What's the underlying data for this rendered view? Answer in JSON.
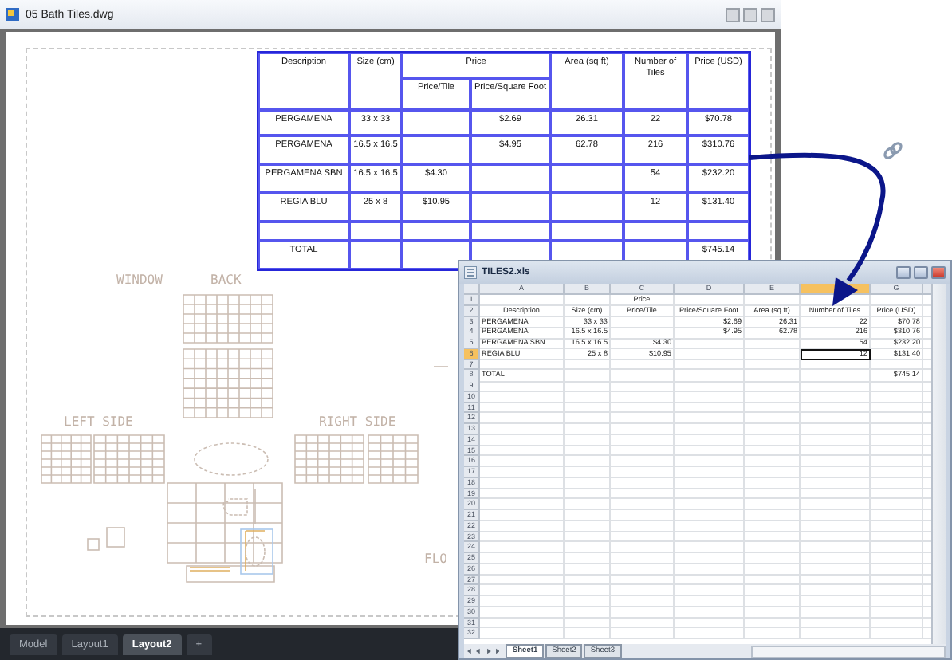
{
  "cad_window": {
    "title": "05 Bath Tiles.dwg",
    "table": {
      "columns": [
        {
          "label": "Description",
          "kind": "single"
        },
        {
          "label": "Size (cm)",
          "kind": "single"
        },
        {
          "label": "Price/Tile",
          "kind": "group_start",
          "group": "Price"
        },
        {
          "label": "Price/Square Foot",
          "kind": "group_member"
        },
        {
          "label": "Area (sq ft)",
          "kind": "single"
        },
        {
          "label": "Number of Tiles",
          "kind": "single"
        },
        {
          "label": "Price (USD)",
          "kind": "single"
        }
      ],
      "rows": [
        {
          "cells": [
            "PERGAMENA",
            "33 x 33",
            null,
            "$2.69",
            "26.31",
            "22",
            "$70.78"
          ]
        },
        {
          "cells": [
            "PERGAMENA",
            "16.5 x 16.5",
            null,
            "$4.95",
            "62.78",
            "216",
            "$310.76"
          ]
        },
        {
          "cells": [
            "PERGAMENA SBN",
            "16.5 x 16.5",
            "$4.30",
            null,
            null,
            "54",
            "$232.20"
          ]
        },
        {
          "cells": [
            "REGIA BLU",
            "25 x 8",
            "$10.95",
            null,
            null,
            "12",
            "$131.40"
          ]
        },
        {
          "cells": [
            null,
            null,
            null,
            null,
            null,
            null,
            null
          ]
        },
        {
          "cells": [
            "TOTAL",
            null,
            null,
            null,
            null,
            null,
            "$745.14"
          ]
        }
      ]
    },
    "drawing_labels": [
      "WINDOW",
      "BACK",
      "LEFT SIDE",
      "RIGHT SIDE",
      "FLO"
    ],
    "layout_tabs": [
      {
        "label": "Model",
        "selected": false
      },
      {
        "label": "Layout1",
        "selected": false
      },
      {
        "label": "Layout2",
        "selected": true
      },
      {
        "label": "+",
        "selected": false
      }
    ]
  },
  "spreadsheet_window": {
    "title": "TILES2.xls",
    "columns": [
      {
        "label": "A",
        "selected": false
      },
      {
        "label": "B",
        "selected": false
      },
      {
        "label": "C",
        "selected": false
      },
      {
        "label": "D",
        "selected": false
      },
      {
        "label": "E",
        "selected": false
      },
      {
        "selected": true
      },
      {
        "label": "G",
        "selected": false
      }
    ],
    "rows": [
      {
        "number": "1",
        "kind": "heading",
        "selected": false,
        "cells": [
          null,
          null,
          "Price",
          null,
          null,
          null,
          null
        ]
      },
      {
        "number": "2",
        "kind": "heading",
        "selected": false,
        "cells": [
          "Description",
          "Size (cm)",
          "Price/Tile",
          "Price/Square Foot",
          "Area (sq ft)",
          "Number of Tiles",
          "Price (USD)"
        ]
      },
      {
        "number": "3",
        "kind": "data",
        "selected": false,
        "cells": [
          "PERGAMENA",
          "33 x 33",
          null,
          "$2.69",
          "26.31",
          "22",
          "$70.78"
        ]
      },
      {
        "number": "4",
        "kind": "data",
        "selected": false,
        "cells": [
          "PERGAMENA",
          "16.5 x 16.5",
          null,
          "$4.95",
          "62.78",
          "216",
          "$310.76"
        ]
      },
      {
        "number": "5",
        "kind": "data",
        "selected": false,
        "cells": [
          "PERGAMENA SBN",
          "16.5 x 16.5",
          "$4.30",
          null,
          null,
          "54",
          "$232.20"
        ]
      },
      {
        "number": "6",
        "kind": "data",
        "selected": true,
        "cells": [
          "REGIA BLU",
          "25 x 8",
          "$10.95",
          null,
          null,
          "12",
          "$131.40"
        ]
      },
      {
        "number": "7",
        "selected": false
      },
      {
        "number": "8",
        "kind": "data",
        "selected": false,
        "cells": [
          "TOTAL",
          null,
          null,
          null,
          null,
          null,
          "$745.14"
        ]
      },
      {
        "number": "9",
        "selected": false
      },
      {
        "number": "10",
        "selected": false
      },
      {
        "number": "11",
        "selected": false
      },
      {
        "number": "12",
        "selected": false
      },
      {
        "number": "13",
        "selected": false
      },
      {
        "number": "14",
        "selected": false
      },
      {
        "number": "15",
        "selected": false
      },
      {
        "number": "16",
        "selected": false
      },
      {
        "number": "17",
        "selected": false
      },
      {
        "number": "18",
        "selected": false
      },
      {
        "number": "19",
        "selected": false
      },
      {
        "number": "20",
        "selected": false
      },
      {
        "number": "21",
        "selected": false
      },
      {
        "number": "22",
        "selected": false
      },
      {
        "number": "23",
        "selected": false
      },
      {
        "number": "24",
        "selected": false
      },
      {
        "number": "25",
        "selected": false
      },
      {
        "number": "26",
        "selected": false
      },
      {
        "number": "27",
        "selected": false
      },
      {
        "number": "28",
        "selected": false
      },
      {
        "number": "29",
        "selected": false
      },
      {
        "number": "30",
        "selected": false
      },
      {
        "number": "31",
        "selected": false
      },
      {
        "number": "32",
        "selected": false
      }
    ],
    "sheet_tabs": [
      {
        "label": "Sheet1",
        "selected": true
      },
      {
        "label": "Sheet2",
        "selected": false
      },
      {
        "label": "Sheet3",
        "selected": false
      }
    ]
  }
}
